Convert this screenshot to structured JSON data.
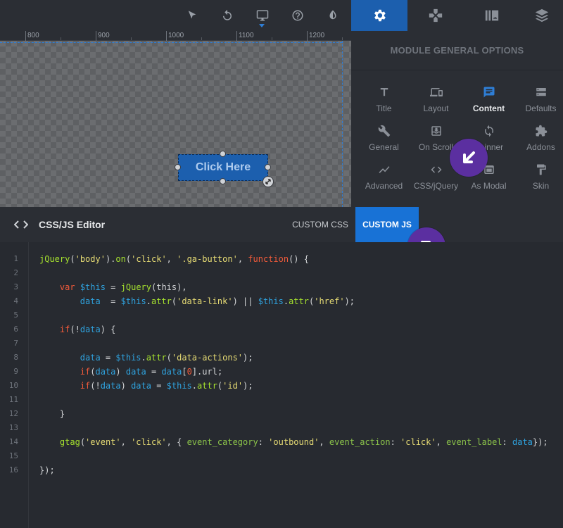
{
  "toolbar": {
    "icons": [
      "cursor-icon",
      "undo-icon",
      "desktop-icon",
      "help-icon",
      "contrast-icon"
    ],
    "tabs": [
      "gear-icon",
      "gamepad-icon",
      "library-icon",
      "layers-icon"
    ],
    "active_tab": "gear-icon"
  },
  "ruler": {
    "labels": [
      "800",
      "900",
      "1000",
      "1100",
      "1200"
    ]
  },
  "canvas": {
    "button_label": "Click Here"
  },
  "side_panel": {
    "title": "MODULE GENERAL OPTIONS",
    "options": [
      {
        "label": "Title",
        "icon": "title-icon"
      },
      {
        "label": "Layout",
        "icon": "layout-icon"
      },
      {
        "label": "Content",
        "icon": "content-icon",
        "active": true
      },
      {
        "label": "Defaults",
        "icon": "defaults-icon"
      },
      {
        "label": "General",
        "icon": "wrench-icon"
      },
      {
        "label": "On Scroll",
        "icon": "on-scroll-icon"
      },
      {
        "label": "Spinner",
        "icon": "spinner-icon"
      },
      {
        "label": "Addons",
        "icon": "puzzle-icon"
      },
      {
        "label": "Advanced",
        "icon": "chart-line-icon"
      },
      {
        "label": "CSS/jQuery",
        "icon": "code-icon"
      },
      {
        "label": "As Modal",
        "icon": "modal-icon"
      },
      {
        "label": "Skin",
        "icon": "paint-roller-icon"
      }
    ]
  },
  "editor": {
    "title": "CSS/JS Editor",
    "tabs": [
      "CUSTOM CSS",
      "CUSTOM JS"
    ],
    "active_tab": "CUSTOM JS",
    "line_numbers": [
      "1",
      "2",
      "3",
      "4",
      "5",
      "6",
      "7",
      "8",
      "9",
      "10",
      "11",
      "12",
      "13",
      "14",
      "15",
      "16"
    ],
    "code_lines": [
      "jQuery('body').on('click', '.ga-button', function() {",
      "",
      "    var $this = jQuery(this),",
      "        data  = $this.attr('data-link') || $this.attr('href');",
      "",
      "    if(!data) {",
      "",
      "        data = $this.attr('data-actions');",
      "        if(data) data = data[0].url;",
      "        if(!data) data = $this.attr('id');",
      "",
      "    }",
      "",
      "    gtag('event', 'click', { event_category: 'outbound', event_action: 'click', event_label: data});",
      "",
      "});"
    ]
  },
  "colors": {
    "accent": "#1c5fae",
    "active_tab": "#1872d6",
    "marker": "#5b2fa0"
  }
}
